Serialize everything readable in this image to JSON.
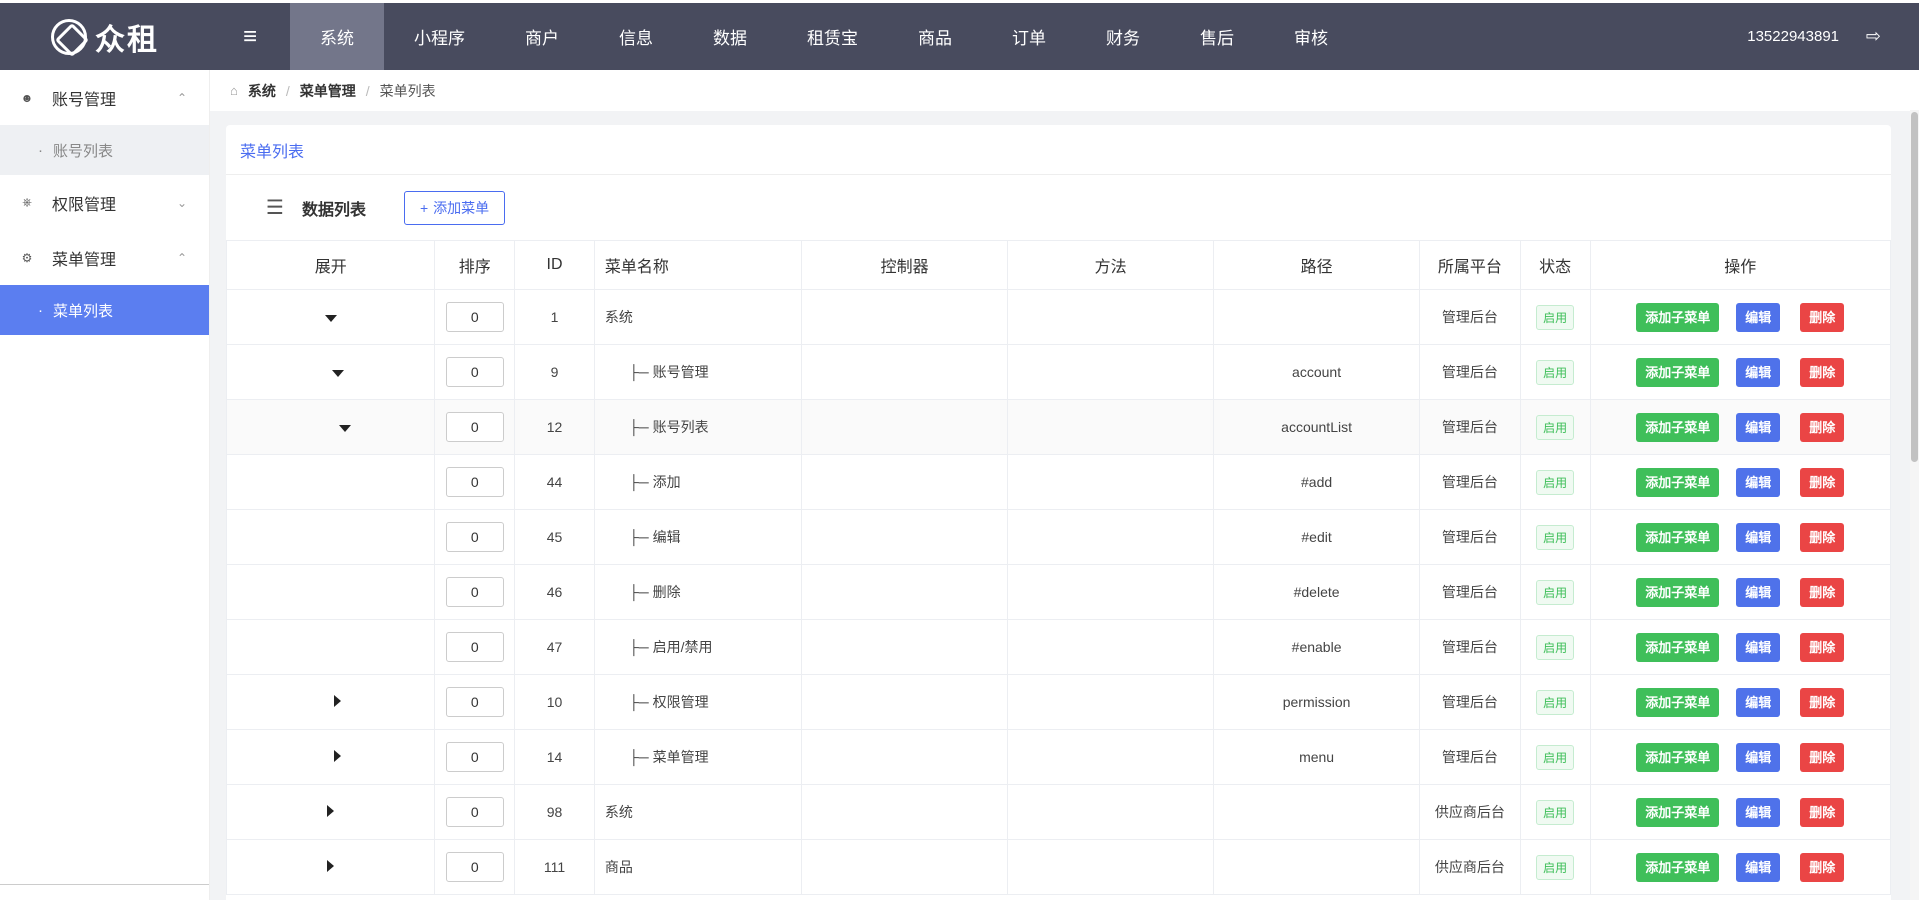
{
  "app": {
    "logo_text": "众租",
    "user": "13522943891"
  },
  "top_nav": [
    {
      "label": "系统",
      "active": true
    },
    {
      "label": "小程序"
    },
    {
      "label": "商户"
    },
    {
      "label": "信息"
    },
    {
      "label": "数据"
    },
    {
      "label": "租赁宝"
    },
    {
      "label": "商品"
    },
    {
      "label": "订单"
    },
    {
      "label": "财务"
    },
    {
      "label": "售后"
    },
    {
      "label": "审核"
    }
  ],
  "sidebar": {
    "groups": [
      {
        "label": "账号管理",
        "icon": "user-icon",
        "expanded": true,
        "subs": [
          "账号列表"
        ]
      },
      {
        "label": "权限管理",
        "icon": "org-chart-icon",
        "expanded": false,
        "subs": []
      },
      {
        "label": "菜单管理",
        "icon": "gear-icon",
        "expanded": true,
        "subs": [
          "菜单列表"
        ]
      }
    ],
    "active_sub": "菜单列表"
  },
  "breadcrumb": [
    "系统",
    "菜单管理",
    "菜单列表"
  ],
  "card": {
    "title": "菜单列表",
    "toolbar_title": "数据列表",
    "add_button": "添加菜单"
  },
  "table": {
    "headers": [
      "展开",
      "排序",
      "ID",
      "菜单名称",
      "控制器",
      "方法",
      "路径",
      "所属平台",
      "状态",
      "操作"
    ],
    "actions": {
      "add_child": "添加子菜单",
      "edit": "编辑",
      "delete": "删除"
    },
    "rows": [
      {
        "expand": "down",
        "sort": "0",
        "id": "1",
        "name": "系统",
        "indent": 0,
        "controller": "",
        "method": "",
        "path": "",
        "platform": "管理后台",
        "status": "启用"
      },
      {
        "expand": "down",
        "sort": "0",
        "id": "9",
        "name": "├─ 账号管理",
        "indent": 1,
        "controller": "",
        "method": "",
        "path": "account",
        "platform": "管理后台",
        "status": "启用"
      },
      {
        "expand": "down",
        "sort": "0",
        "id": "12",
        "name": "├─ 账号列表",
        "indent": 1,
        "controller": "",
        "method": "",
        "path": "accountList",
        "platform": "管理后台",
        "status": "启用"
      },
      {
        "expand": "",
        "sort": "0",
        "id": "44",
        "name": "├─ 添加",
        "indent": 1,
        "controller": "",
        "method": "",
        "path": "#add",
        "platform": "管理后台",
        "status": "启用"
      },
      {
        "expand": "",
        "sort": "0",
        "id": "45",
        "name": "├─ 编辑",
        "indent": 1,
        "controller": "",
        "method": "",
        "path": "#edit",
        "platform": "管理后台",
        "status": "启用"
      },
      {
        "expand": "",
        "sort": "0",
        "id": "46",
        "name": "├─ 删除",
        "indent": 1,
        "controller": "",
        "method": "",
        "path": "#delete",
        "platform": "管理后台",
        "status": "启用"
      },
      {
        "expand": "",
        "sort": "0",
        "id": "47",
        "name": "├─ 启用/禁用",
        "indent": 1,
        "controller": "",
        "method": "",
        "path": "#enable",
        "platform": "管理后台",
        "status": "启用"
      },
      {
        "expand": "right",
        "sort": "0",
        "id": "10",
        "name": "├─ 权限管理",
        "indent": 1,
        "controller": "",
        "method": "",
        "path": "permission",
        "platform": "管理后台",
        "status": "启用"
      },
      {
        "expand": "right",
        "sort": "0",
        "id": "14",
        "name": "├─ 菜单管理",
        "indent": 1,
        "controller": "",
        "method": "",
        "path": "menu",
        "platform": "管理后台",
        "status": "启用"
      },
      {
        "expand": "right",
        "sort": "0",
        "id": "98",
        "name": "系统",
        "indent": 0,
        "controller": "",
        "method": "",
        "path": "",
        "platform": "供应商后台",
        "status": "启用"
      },
      {
        "expand": "right",
        "sort": "0",
        "id": "111",
        "name": "商品",
        "indent": 0,
        "controller": "",
        "method": "",
        "path": "",
        "platform": "供应商后台",
        "status": "启用"
      }
    ]
  },
  "colors": {
    "topbar": "#484b5e",
    "accent": "#4a6cf0",
    "success": "#3fbf5a",
    "danger": "#ea4545"
  }
}
